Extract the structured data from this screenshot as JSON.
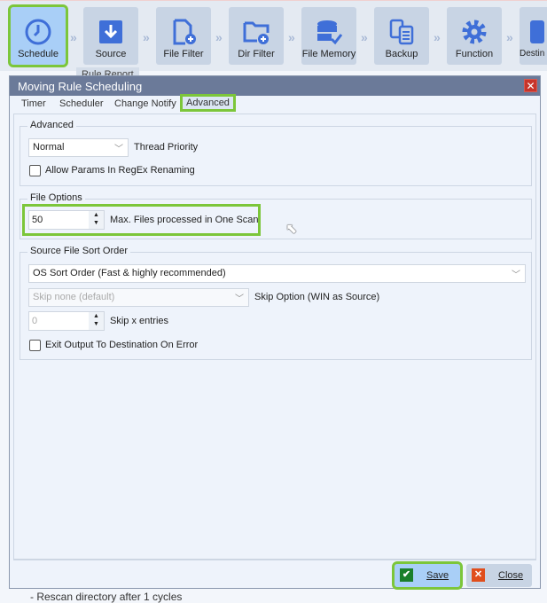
{
  "toolbar": {
    "items": [
      {
        "label": "Schedule",
        "icon": "clock-icon",
        "active": true
      },
      {
        "label": "Source",
        "icon": "download-icon"
      },
      {
        "label": "File Filter",
        "icon": "file-add-icon"
      },
      {
        "label": "Dir Filter",
        "icon": "folder-add-icon"
      },
      {
        "label": "File Memory",
        "icon": "database-check-icon"
      },
      {
        "label": "Backup",
        "icon": "copy-icon"
      },
      {
        "label": "Function",
        "icon": "gear-icon"
      },
      {
        "label": "Destin",
        "icon": "destination-icon"
      }
    ]
  },
  "background": {
    "tab_active": "Rule Report",
    "text": "- Rescan directory after 1 cycles"
  },
  "dialog": {
    "title": "Moving Rule Scheduling",
    "tabs": [
      "Timer",
      "Scheduler",
      "Change Notify",
      "Advanced"
    ],
    "active_tab": "Advanced",
    "advanced": {
      "title": "Advanced",
      "priority_value": "Normal",
      "priority_label": "Thread Priority",
      "allow_params_label": "Allow Params In RegEx Renaming",
      "allow_params_checked": false
    },
    "file_options": {
      "title": "File Options",
      "max_files_value": "50",
      "max_files_label": "Max. Files processed in One Scan"
    },
    "sort": {
      "title": "Source File Sort Order",
      "order_value": "OS Sort Order (Fast & highly recommended)",
      "skip_option_value": "Skip none (default)",
      "skip_option_label": "Skip Option (WIN as Source)",
      "skip_entries_value": "0",
      "skip_entries_label": "Skip x entries",
      "exit_output_label": "Exit Output To Destination On Error",
      "exit_output_checked": false
    },
    "save_label": "Save",
    "close_label": "Close"
  },
  "colors": {
    "highlight": "#7cc63a",
    "titlebar": "#6b7a99",
    "icon": "#3f6fd8"
  }
}
